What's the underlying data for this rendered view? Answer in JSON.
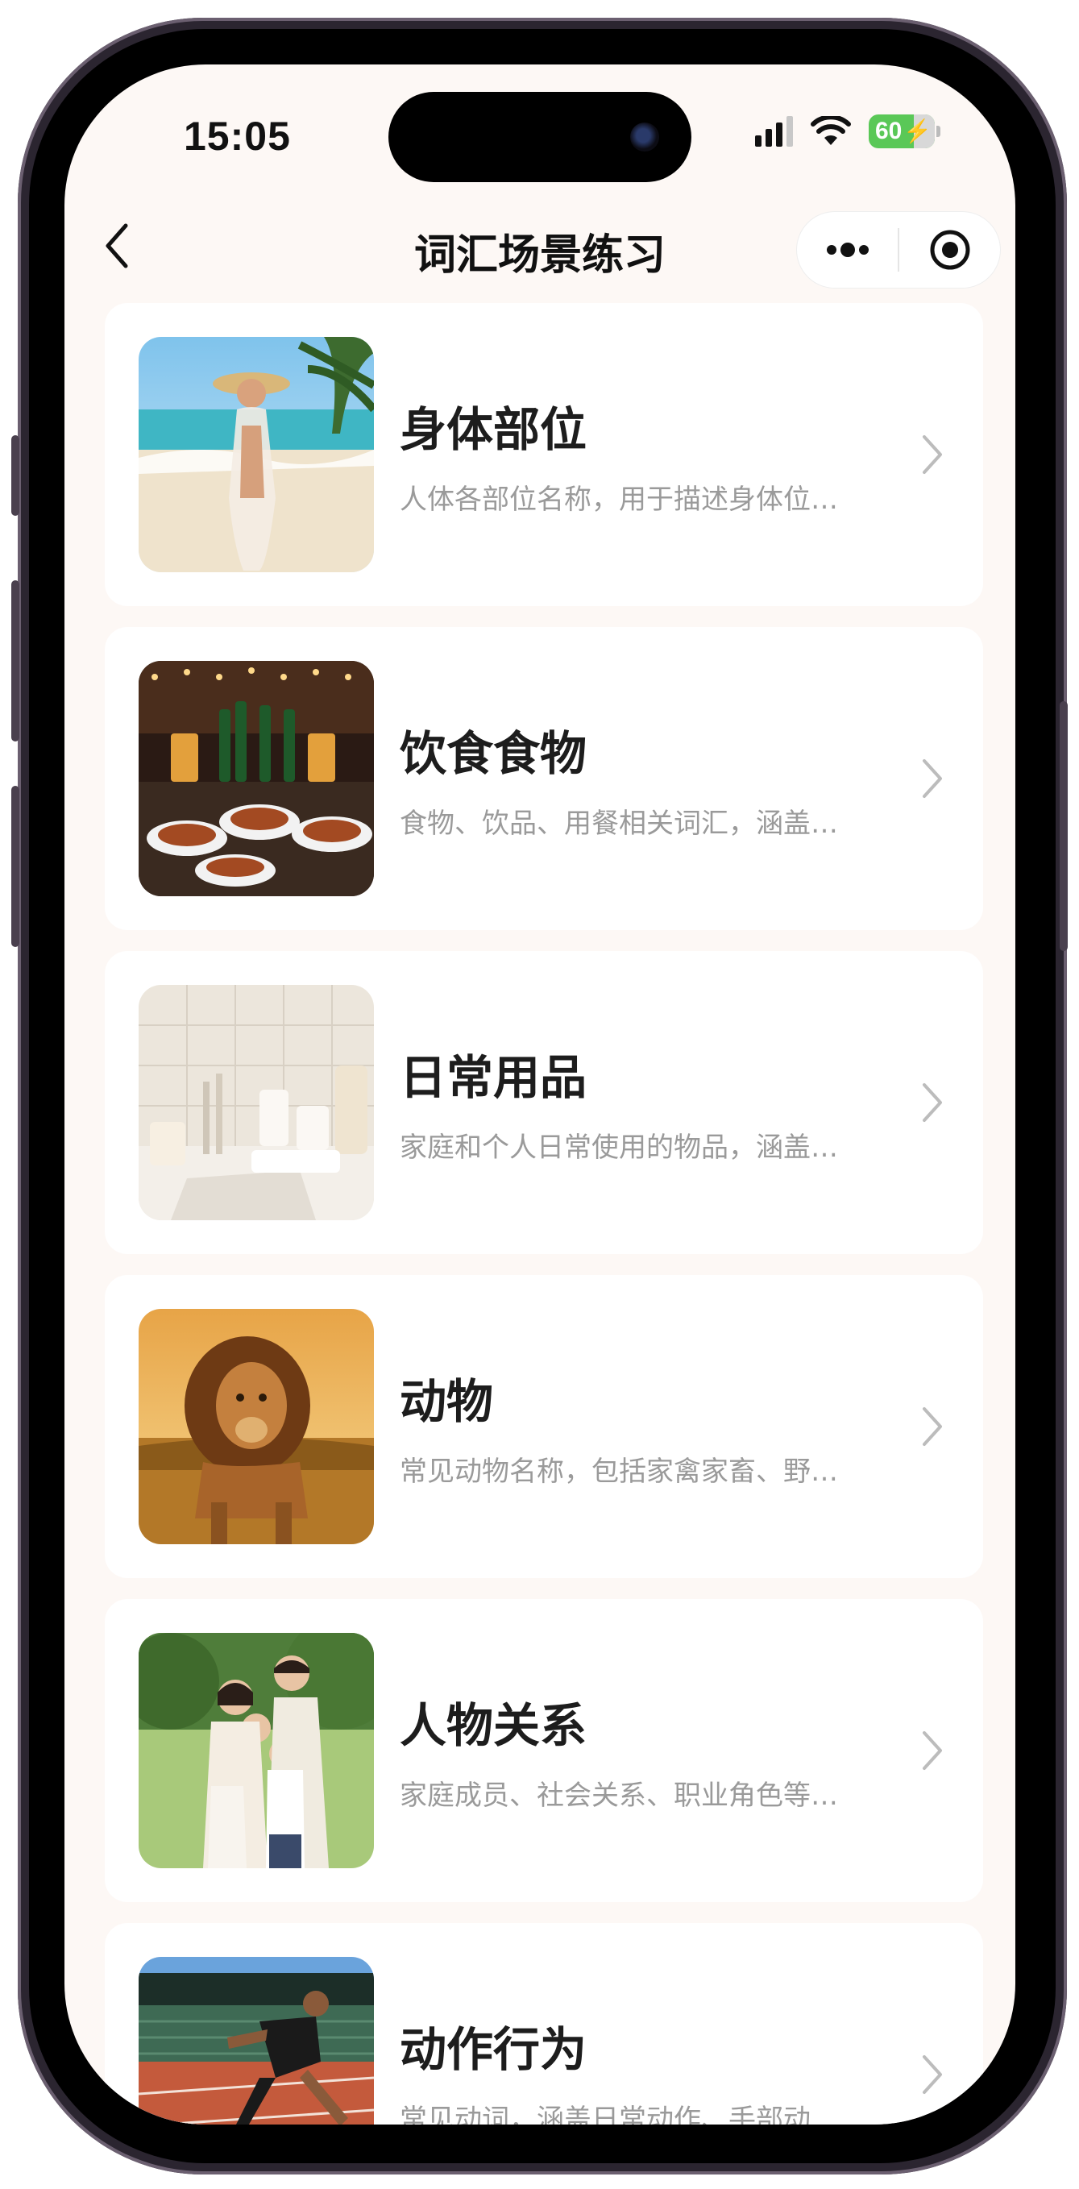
{
  "status_bar": {
    "time": "15:05",
    "battery": "60"
  },
  "nav": {
    "title": "词汇场景练习"
  },
  "categories": [
    {
      "title": "身体部位",
      "description": "人体各部位名称，用于描述身体位…"
    },
    {
      "title": "饮食食物",
      "description": "食物、饮品、用餐相关词汇，涵盖…"
    },
    {
      "title": "日常用品",
      "description": "家庭和个人日常使用的物品，涵盖…"
    },
    {
      "title": "动物",
      "description": "常见动物名称，包括家禽家畜、野…"
    },
    {
      "title": "人物关系",
      "description": "家庭成员、社会关系、职业角色等…"
    },
    {
      "title": "动作行为",
      "description": "常见动词，涵盖日常动作、手部动…"
    }
  ],
  "colors": {
    "background": "#fdf8f5",
    "card": "#ffffff",
    "battery": "#5ac857"
  },
  "icons": [
    "chevron-left-icon",
    "more-dots-icon",
    "target-circle-icon",
    "chevron-right-icon",
    "signal-icon",
    "wifi-icon",
    "battery-icon"
  ]
}
